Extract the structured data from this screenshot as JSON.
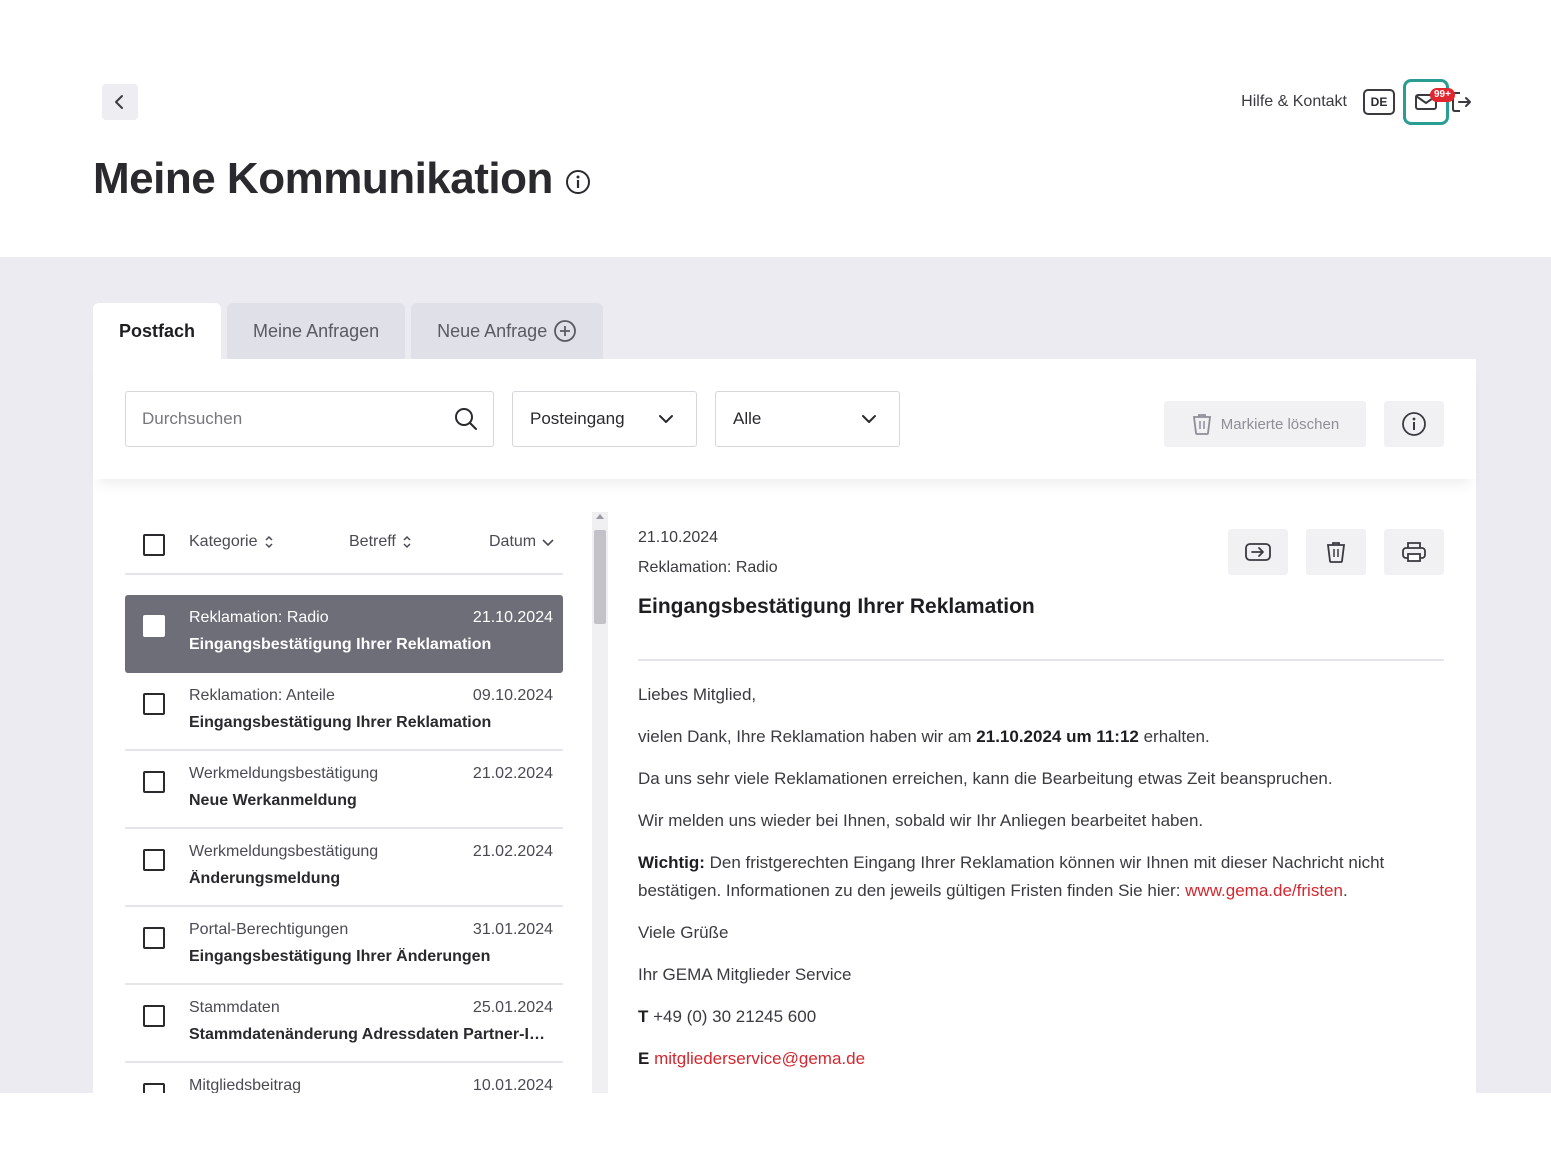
{
  "header": {
    "help_label": "Hilfe & Kontakt",
    "lang_label": "DE",
    "mail_badge": "99+"
  },
  "page": {
    "title": "Meine Kommunikation"
  },
  "tabs": [
    {
      "label": "Postfach",
      "active": true
    },
    {
      "label": "Meine Anfragen",
      "active": false
    },
    {
      "label": "Neue Anfrage",
      "active": false
    }
  ],
  "toolbar": {
    "search_placeholder": "Durchsuchen",
    "folder_value": "Posteingang",
    "filter_value": "Alle",
    "delete_marked_label": "Markierte löschen"
  },
  "list": {
    "columns": {
      "category": "Kategorie",
      "subject": "Betreff",
      "date": "Datum"
    },
    "items": [
      {
        "category": "Reklamation: Radio",
        "date": "21.10.2024",
        "subject": "Eingangsbestätigung Ihrer Reklamation"
      },
      {
        "category": "Reklamation: Anteile",
        "date": "09.10.2024",
        "subject": "Eingangsbestätigung Ihrer Reklamation"
      },
      {
        "category": "Werkmeldungsbestätigung",
        "date": "21.02.2024",
        "subject": "Neue Werkanmeldung"
      },
      {
        "category": "Werkmeldungsbestätigung",
        "date": "21.02.2024",
        "subject": "Änderungsmeldung"
      },
      {
        "category": "Portal-Berechtigungen",
        "date": "31.01.2024",
        "subject": "Eingangsbestätigung Ihrer Änderungen"
      },
      {
        "category": "Stammdaten",
        "date": "25.01.2024",
        "subject": "Stammdatenänderung Adressdaten Partner-ID..."
      },
      {
        "category": "Mitgliedsbeitrag",
        "date": "10.01.2024",
        "subject": ""
      }
    ]
  },
  "message": {
    "date": "21.10.2024",
    "category": "Reklamation: Radio",
    "subject": "Eingangsbestätigung Ihrer Reklamation",
    "greeting": "Liebes Mitglied,",
    "line1_pre": "vielen Dank, Ihre Reklamation haben wir am ",
    "line1_bold": "21.10.2024 um 11:12",
    "line1_post": " erhalten.",
    "line2": "Da uns sehr viele Reklamationen erreichen, kann die Bearbeitung etwas Zeit beanspruchen.",
    "line3": "Wir melden uns wieder bei Ihnen, sobald wir Ihr Anliegen bearbeitet haben.",
    "important_label": "Wichtig:",
    "important_text": " Den fristgerechten Eingang Ihrer Reklamation können wir Ihnen mit dieser Nachricht nicht bestätigen. Informationen zu den jeweils gültigen Fristen finden Sie hier: ",
    "important_link": "www.gema.de/fristen",
    "important_end": ".",
    "closing": "Viele Grüße",
    "signature": "Ihr GEMA Mitglieder Service",
    "phone_label": "T",
    "phone": " +49 (0) 30 21245 600",
    "email_label": "E",
    "email": "mitgliederservice@gema.de"
  },
  "colors": {
    "accent_teal": "#2a9d93",
    "link_red": "#d4272f",
    "badge_red": "#e0262f",
    "selected_row": "#6d6e78"
  }
}
